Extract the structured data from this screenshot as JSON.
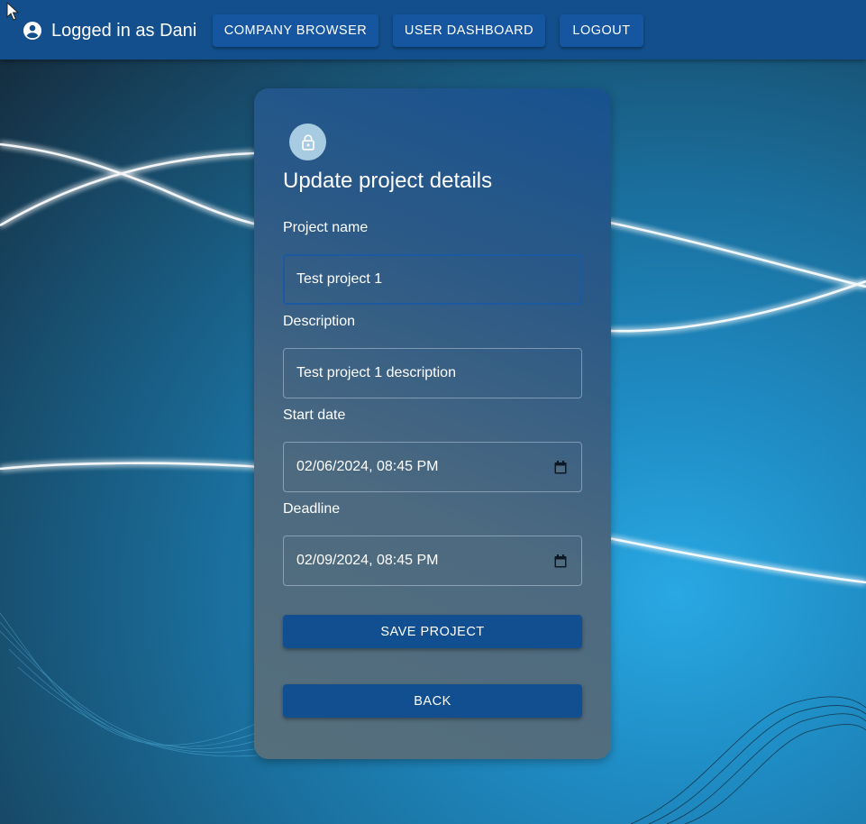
{
  "header": {
    "user_label": "Logged in as Dani",
    "nav": [
      {
        "label": "COMPANY BROWSER"
      },
      {
        "label": "USER DASHBOARD"
      },
      {
        "label": "LOGOUT"
      }
    ]
  },
  "form": {
    "title": "Update project details",
    "fields": [
      {
        "label": "Project name",
        "value": "Test project 1"
      },
      {
        "label": "Description",
        "value": "Test project 1 description"
      },
      {
        "label": "Start date",
        "value": "02/06/2024, 08:45 PM"
      },
      {
        "label": "Deadline",
        "value": "02/09/2024, 08:45 PM"
      }
    ],
    "save_label": "SAVE PROJECT",
    "back_label": "BACK"
  },
  "colors": {
    "topbar": "#124f8c",
    "button": "#124f91",
    "lock_badge": "#a7cbe0"
  },
  "icons": {
    "user": "account-circle-icon",
    "lock": "lock-icon",
    "calendar": "calendar-icon"
  }
}
